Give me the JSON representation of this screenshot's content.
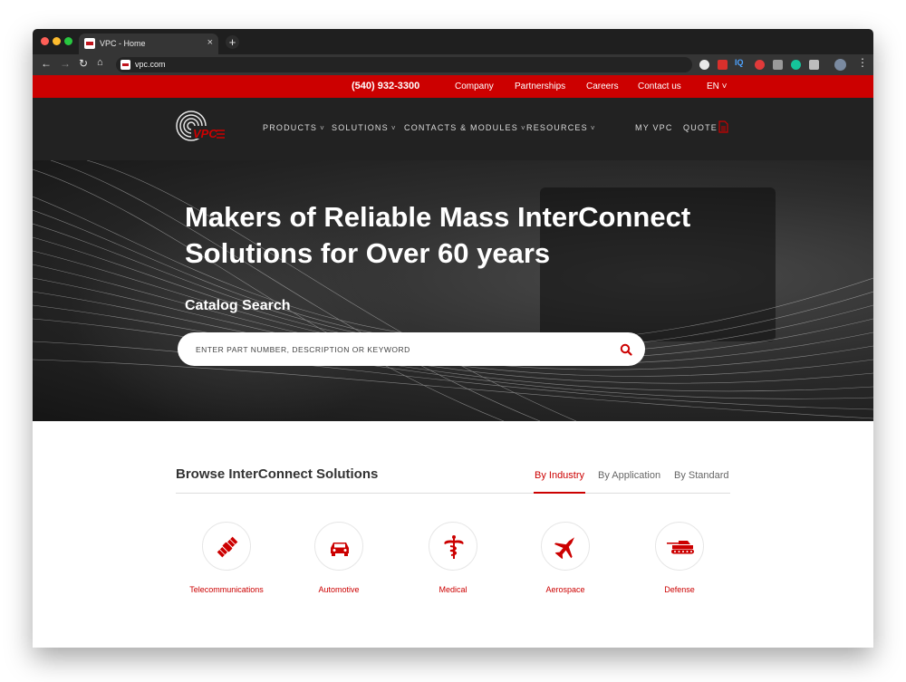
{
  "browser": {
    "tab_title": "VPC - Home",
    "tab_close": "×",
    "new_tab": "+",
    "url": "vpc.com"
  },
  "utility_bar": {
    "phone": "(540) 932-3300",
    "links": [
      "Company",
      "Partnerships",
      "Careers",
      "Contact us"
    ],
    "language": "EN ˅"
  },
  "main_nav": {
    "items": [
      "PRODUCTS",
      "SOLUTIONS",
      "CONTACTS & MODULES",
      "RESOURCES"
    ],
    "my_vpc": "MY VPC",
    "quote": "QUOTE"
  },
  "hero": {
    "headline": "Makers of Reliable Mass InterConnect Solutions for Over 60 years",
    "catalog_label": "Catalog Search",
    "search_placeholder": "ENTER PART NUMBER, DESCRIPTION OR KEYWORD"
  },
  "browse": {
    "title": "Browse InterConnect Solutions",
    "tabs": [
      "By Industry",
      "By Application",
      "By Standard"
    ],
    "active_tab": "By Industry",
    "industries": [
      {
        "label": "Telecommunications",
        "icon": "satellite-icon"
      },
      {
        "label": "Automotive",
        "icon": "car-icon"
      },
      {
        "label": "Medical",
        "icon": "caduceus-icon"
      },
      {
        "label": "Aerospace",
        "icon": "jet-icon"
      },
      {
        "label": "Defense",
        "icon": "tank-icon"
      }
    ]
  },
  "colors": {
    "brand_red": "#cc0000",
    "nav_dark": "#222222",
    "tab_strip": "#1f1f1f"
  }
}
